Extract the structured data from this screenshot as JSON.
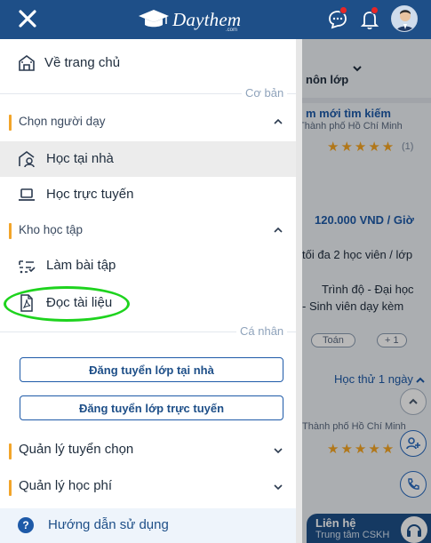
{
  "header": {
    "brand": "Daythem",
    "brand_suffix": ".com",
    "close_icon": "close-icon",
    "chat_icon": "chat-icon",
    "bell_icon": "bell-icon",
    "accent": "#1e4f88",
    "badge_color": "#e82626"
  },
  "drawer": {
    "home_label": "Về trang chủ",
    "section_basic": "Cơ bản",
    "group_tutor": "Chọn người dạy",
    "tutor_items": [
      {
        "label": "Học tại nhà",
        "icon": "home-study-icon",
        "selected": true
      },
      {
        "label": "Học trực tuyến",
        "icon": "laptop-icon",
        "selected": false
      }
    ],
    "group_learning": "Kho học tập",
    "learning_items": [
      {
        "label": "Làm bài tập",
        "icon": "exercise-icon"
      },
      {
        "label": "Đọc tài liệu",
        "icon": "pdf-document-icon"
      }
    ],
    "section_personal": "Cá nhân",
    "btn_post_home": "Đăng tuyển lớp tại nhà",
    "btn_post_online": "Đăng tuyển lớp trực tuyến",
    "group_manage_selection": "Quản lý tuyển chọn",
    "group_manage_fee": "Quản lý học phí",
    "help_label": "Hướng dẫn sử dụng",
    "group_marker_color": "#f2a52a"
  },
  "background": {
    "filter_text": "nôn lớp",
    "search_more": "m mới tìm kiếm",
    "location_1": "Thành phố Hồ Chí Minh",
    "rating_count": "(1)",
    "price": "120.000 VND / Giờ",
    "capacity": "tối đa 2 học viên / lớp",
    "level": "Trình độ - Đại học",
    "teacher_type": "- Sinh viên dạy kèm",
    "subject_chip": "Toán",
    "more_chip": "+ 1",
    "trial": "Học thử 1 ngày",
    "location_2": "Thành phố Hồ Chí Minh",
    "contact_title": "Liên hệ",
    "contact_sub": "Trung tâm CSKH"
  }
}
